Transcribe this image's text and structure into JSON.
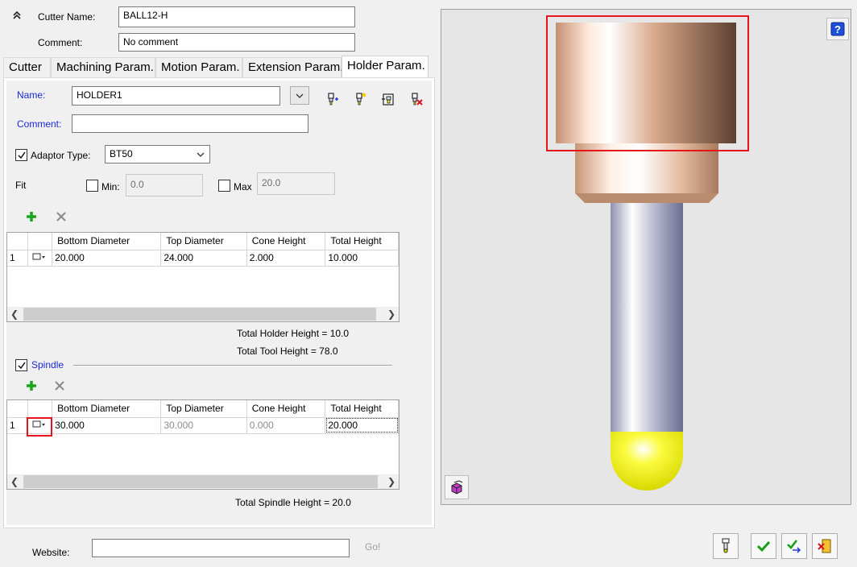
{
  "header": {
    "cutter_name_label": "Cutter Name:",
    "cutter_name_value": "BALL12-H",
    "comment_label": "Comment:",
    "comment_value": "No comment"
  },
  "tabs": [
    {
      "label": "Cutter",
      "active": false
    },
    {
      "label": "Machining Param.",
      "active": false
    },
    {
      "label": "Motion Param.",
      "active": false
    },
    {
      "label": "Extension Param.",
      "active": false
    },
    {
      "label": "Holder Param.",
      "active": true
    }
  ],
  "holder": {
    "name_label": "Name:",
    "name_value": "HOLDER1",
    "comment_label": "Comment:",
    "comment_value": "",
    "adaptor_label": "Adaptor Type:",
    "adaptor_checked": true,
    "adaptor_value": "BT50",
    "fit_label": "Fit",
    "min_label": "Min:",
    "min_value": "0.0",
    "max_label": "Max",
    "max_value": "20.0"
  },
  "holder_table": {
    "columns": [
      "Bottom Diameter",
      "Top Diameter",
      "Cone Height",
      "Total Height"
    ],
    "rows": [
      {
        "index": "1",
        "bottom": "20.000",
        "top": "24.000",
        "cone": "2.000",
        "total": "10.000"
      }
    ],
    "total_holder_height": "Total Holder Height = 10.0",
    "total_tool_height": "Total Tool Height = 78.0"
  },
  "spindle": {
    "label": "Spindle",
    "checked": true,
    "columns": [
      "Bottom Diameter",
      "Top Diameter",
      "Cone Height",
      "Total Height"
    ],
    "rows": [
      {
        "index": "1",
        "bottom": "30.000",
        "top": "30.000",
        "cone": "0.000",
        "total": "20.000"
      }
    ],
    "total_spindle_height": "Total Spindle Height = 20.0"
  },
  "footer": {
    "website_label": "Website:",
    "website_value": "",
    "go_label": "Go!"
  },
  "colors": {
    "highlight": "#e8141c",
    "label_blue": "#1a2ad8",
    "ball_yellow": "#f2f200",
    "holder_copper": "#c48f6e"
  }
}
